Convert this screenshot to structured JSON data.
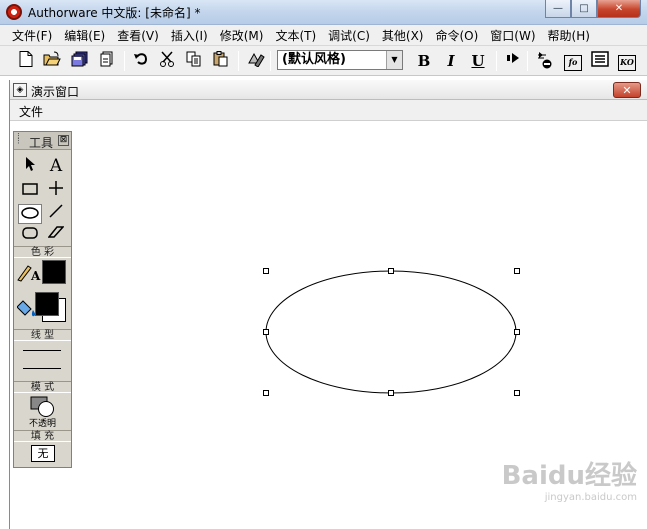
{
  "app": {
    "title": "Authorware 中文版: [未命名] *"
  },
  "window_controls": {
    "minimize": "—",
    "maximize": "□",
    "close": "✕"
  },
  "menu": [
    "文件(F)",
    "编辑(E)",
    "查看(V)",
    "插入(I)",
    "修改(M)",
    "文本(T)",
    "调试(C)",
    "其他(X)",
    "命令(O)",
    "窗口(W)",
    "帮助(H)"
  ],
  "toolbar": {
    "style_value": "(默认风格)",
    "bold": "B",
    "italic": "I",
    "underline": "U",
    "func_label": "fo",
    "ko_label": "KO",
    "icons": [
      "new-icon",
      "open-icon",
      "save-all-icon",
      "import-icon",
      "undo-icon",
      "cut-icon",
      "copy-icon",
      "paste-icon",
      "find-icon",
      "run-icon",
      "control-panel-icon",
      "functions-icon",
      "variables-icon",
      "knowledge-objects-icon"
    ]
  },
  "presentation": {
    "title": "演示窗口",
    "menu_file": "文件",
    "close": "✕"
  },
  "tools": {
    "title": "工具",
    "close": "⊠",
    "color_label": "色 彩",
    "line_label": "线 型",
    "mode_label": "模 式",
    "mode_value": "不透明",
    "fill_label": "填 充",
    "fill_value": "无",
    "text_tool": "A",
    "text_color_letter": "A",
    "colors": {
      "line": "#000000",
      "fill_fg": "#000000",
      "fill_bg": "#ffffff"
    }
  },
  "canvas": {
    "selected_shape": "ellipse"
  },
  "watermark": {
    "logo": "Baidu经验",
    "url": "jingyan.baidu.com"
  }
}
